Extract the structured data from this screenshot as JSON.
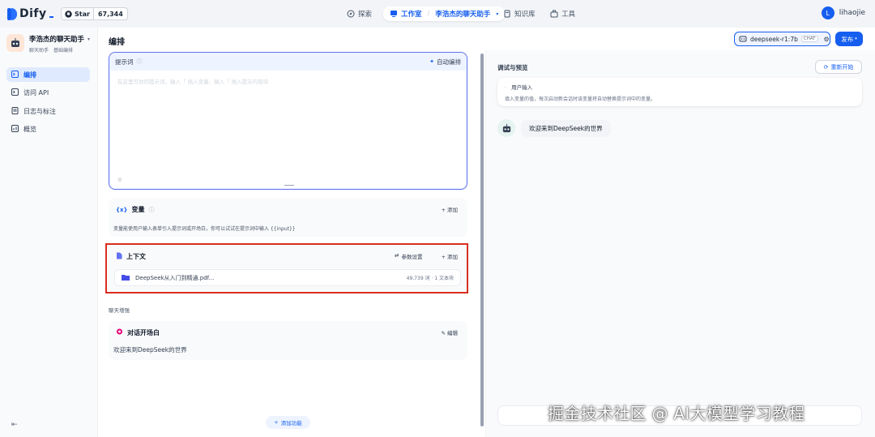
{
  "topbar": {
    "brand": "Dify",
    "github_star_label": "Star",
    "github_star_count": "67,344",
    "nav": {
      "explore": "探索",
      "studio": "工作室",
      "current_app": "李浩杰的聊天助手",
      "knowledge": "知识库",
      "tools": "工具"
    },
    "user_initial": "L",
    "username": "lihaojie"
  },
  "sidebar": {
    "app_name": "李浩杰的聊天助手",
    "app_type": "聊天助手",
    "app_mode": "基础编排",
    "items": [
      {
        "label": "编排"
      },
      {
        "label": "访问 API"
      },
      {
        "label": "日志与标注"
      },
      {
        "label": "概览"
      }
    ]
  },
  "header": {
    "title": "编排",
    "model_name": "deepseek-r1:7b",
    "model_badge": "CHAT",
    "publish": "发布"
  },
  "prompt": {
    "label": "提示词",
    "auto_label": "自动编排",
    "placeholder": "在这里写你的提示词，输入「 插入变量、输入「 插入提示内容块",
    "char_count": "0"
  },
  "variables": {
    "title": "变量",
    "add": "添加",
    "description": "变量能使用户输入表单引入提示词或开场白，你可以试试在提示词中输入 {{input}}"
  },
  "context": {
    "title": "上下文",
    "settings": "参数设置",
    "add": "添加",
    "file_name": "DeepSeek从入门到精通.pdf...",
    "file_meta": "49,739 词 · 1 文本块"
  },
  "chat_enhance": {
    "section_label": "聊天增强",
    "opener_title": "对话开场白",
    "edit": "编辑",
    "opener_text": "欢迎来到DeepSeek的世界"
  },
  "add_feature": "添加功能",
  "debug": {
    "title": "调试与预览",
    "restart": "重新开始",
    "user_input_title": "用户输入",
    "user_input_desc": "填入变量的值，每次启动新会话时该变量将自动替换提示词中的变量。",
    "bot_message": "欢迎来到DeepSeek的世界"
  },
  "watermark": "掘金技术社区 @ AI大模型学习教程",
  "colors": {
    "accent": "#155eef",
    "highlight_border": "#d92d20",
    "prompt_border": "#6172f3"
  }
}
